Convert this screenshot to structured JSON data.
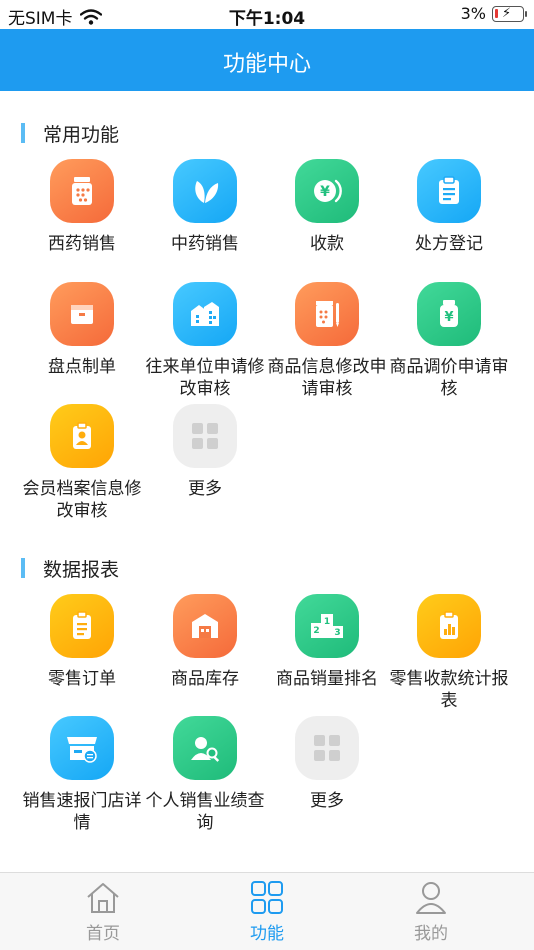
{
  "status_bar": {
    "carrier": "无SIM卡",
    "time": "下午1:04",
    "battery": "3%"
  },
  "header": {
    "title": "功能中心"
  },
  "sections": [
    {
      "title": "常用功能",
      "items": [
        {
          "label": "西药销售",
          "icon": "medicine-bottle-icon",
          "color": "#f57a45"
        },
        {
          "label": "中药销售",
          "icon": "leaf-icon",
          "color": "#1eaaf5"
        },
        {
          "label": "收款",
          "icon": "yuan-coin-icon",
          "color": "#22c07f"
        },
        {
          "label": "处方登记",
          "icon": "clipboard-icon",
          "color": "#1eaaf5"
        },
        {
          "label": "盘点制单",
          "icon": "box-icon",
          "color": "#f57a45"
        },
        {
          "label": "往来单位申请修改审核",
          "icon": "building-icon",
          "color": "#1eaaf5"
        },
        {
          "label": "商品信息修改申请审核",
          "icon": "product-edit-icon",
          "color": "#f57a45"
        },
        {
          "label": "商品调价申请审核",
          "icon": "price-jar-icon",
          "color": "#22c07f"
        },
        {
          "label": "会员档案信息修改审核",
          "icon": "member-badge-icon",
          "color": "#ffad0d"
        },
        {
          "label": "更多",
          "icon": "grid-more-icon",
          "color": "#dddddd"
        }
      ]
    },
    {
      "title": "数据报表",
      "items": [
        {
          "label": "零售订单",
          "icon": "order-list-icon",
          "color": "#ffad0d"
        },
        {
          "label": "商品库存",
          "icon": "warehouse-icon",
          "color": "#f57a45"
        },
        {
          "label": "商品销量排名",
          "icon": "podium-icon",
          "color": "#22c07f"
        },
        {
          "label": "零售收款统计报表",
          "icon": "bar-report-icon",
          "color": "#ffad0d"
        },
        {
          "label": "销售速报门店详情",
          "icon": "storefront-icon",
          "color": "#1eaaf5"
        },
        {
          "label": "个人销售业绩查询",
          "icon": "person-search-icon",
          "color": "#22c07f"
        },
        {
          "label": "更多",
          "icon": "grid-more-icon",
          "color": "#dddddd"
        }
      ]
    }
  ],
  "tabbar": {
    "items": [
      {
        "label": "首页",
        "icon": "home-icon",
        "active": false
      },
      {
        "label": "功能",
        "icon": "grid-icon",
        "active": true
      },
      {
        "label": "我的",
        "icon": "user-icon",
        "active": false
      }
    ]
  }
}
